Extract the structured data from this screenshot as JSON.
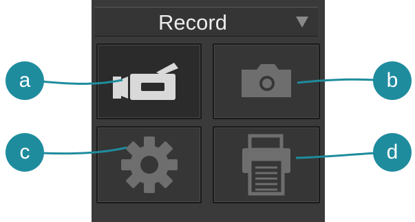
{
  "header": {
    "title": "Record",
    "dropdown_icon": "triangle-down-icon"
  },
  "tools": [
    {
      "name": "video-record",
      "icon": "video-camera-icon",
      "state": "active"
    },
    {
      "name": "snapshot",
      "icon": "camera-icon",
      "state": "idle"
    },
    {
      "name": "settings",
      "icon": "gear-icon",
      "state": "idle"
    },
    {
      "name": "print",
      "icon": "printer-icon",
      "state": "idle"
    }
  ],
  "callouts": {
    "a": "a",
    "b": "b",
    "c": "c",
    "d": "d"
  },
  "colors": {
    "panel": "#3a3a3a",
    "callout": "#1f8c9e",
    "icon_active": "#d9d9d9",
    "icon_idle": "#6e6e6e"
  }
}
